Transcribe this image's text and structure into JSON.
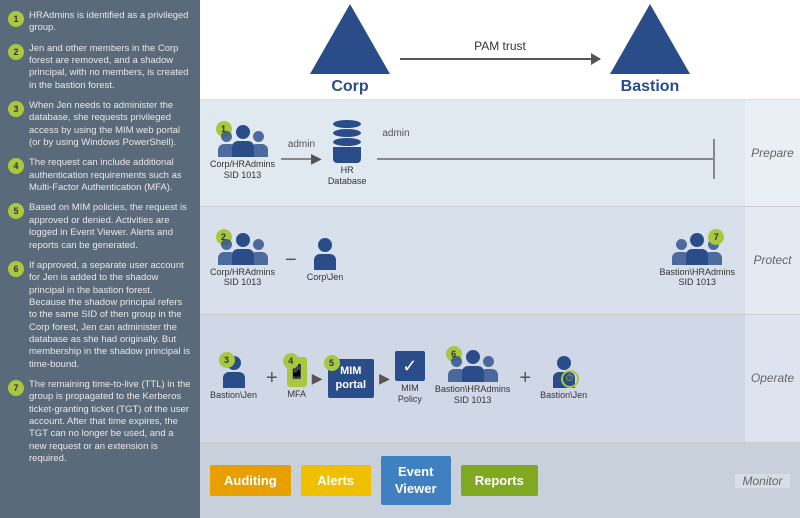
{
  "leftPanel": {
    "steps": [
      {
        "num": "1",
        "text": "HRAdmins is identified as a privileged group."
      },
      {
        "num": "2",
        "text": "Jen and other members in the Corp forest are removed, and a shadow principal, with no members, is created in the bastion forest."
      },
      {
        "num": "3",
        "text": "When Jen needs to administer the database, she requests privileged access by using the MIM web portal (or by using Windows PowerShell)."
      },
      {
        "num": "4",
        "text": "The request can include additional authentication requirements such as Multi-Factor Authentication (MFA)."
      },
      {
        "num": "5",
        "text": "Based on MIM policies, the request is approved or denied. Activities are logged in Event Viewer. Alerts and reports can be generated."
      },
      {
        "num": "6",
        "text": "If approved, a separate user account for Jen is added to the shadow principal in the bastion forest. Because the shadow principal refers to the same SID of then group in the Corp forest, Jen can administer the database as she had originally. But membership in the shadow principal is time-bound."
      },
      {
        "num": "7",
        "text": "The remaining time-to-live (TTL) in the group is propagated to the Kerberos ticket-granting ticket (TGT) of the user account. After that time expires, the TGT can no longer be used, and a new request or an extension is required."
      }
    ]
  },
  "topArea": {
    "corp": "Corp",
    "bastion": "Bastion",
    "pamTrust": "PAM trust"
  },
  "sections": {
    "prepare": "Prepare",
    "protect": "Protect",
    "operate": "Operate",
    "monitor": "Monitor"
  },
  "prepareRow": {
    "stepNum": "1",
    "groupLabel": "Corp/HRAdmins\nSID 1013",
    "adminLeftLabel": "admin",
    "adminRightLabel": "admin",
    "dbLabel": "HR\nDatabase"
  },
  "protectRow": {
    "stepNum": "2",
    "corpGroupLabel": "Corp/HRAdmins\nSID 1013",
    "corpJenLabel": "Corp\\Jen",
    "bastionGroupLabel": "Bastion\\HRAdmins\nSID 1013",
    "stepNum7": "7"
  },
  "operateRow": {
    "steps": [
      "3",
      "4",
      "5",
      "6"
    ],
    "bastionJenLabel": "Bastion\\Jen",
    "mfaLabel": "MFA",
    "mimPortalLine1": "MIM",
    "mimPortalLine2": "portal",
    "mimPolicyLabel": "MIM\nPolicy",
    "bastionHRLabel": "Bastion\\HRAdmins\nSID 1013",
    "bastionJen2Label": "Bastion\\Jen"
  },
  "monitorRow": {
    "badges": [
      {
        "label": "Auditing",
        "color": "badge-orange"
      },
      {
        "label": "Alerts",
        "color": "badge-yellow"
      },
      {
        "label": "Event\nViewer",
        "color": "badge-blue"
      },
      {
        "label": "Reports",
        "color": "badge-green"
      }
    ]
  }
}
